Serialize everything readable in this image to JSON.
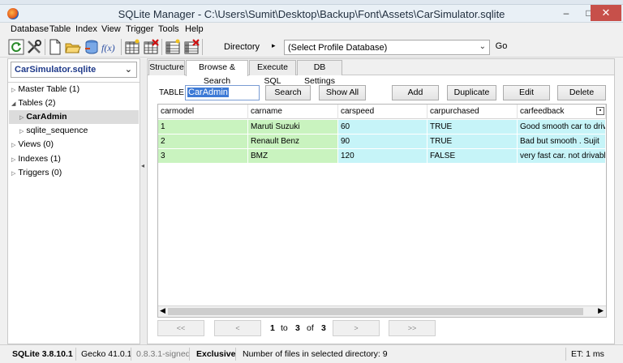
{
  "titlebar": {
    "title": "SQLite Manager - C:\\Users\\Sumit\\Desktop\\Backup\\Font\\Assets\\CarSimulator.sqlite",
    "minimize": "–",
    "maximize": "□",
    "close": "✕"
  },
  "menu": [
    "Database",
    "Table",
    "Index",
    "View",
    "Trigger",
    "Tools",
    "Help"
  ],
  "toolbar": {
    "directory_label": "Directory",
    "directory_arrow": "▸",
    "profile_db": "(Select Profile Database)",
    "go_label": "Go",
    "icons": [
      "refresh-icon",
      "settings-tools-icon",
      "new-db-icon",
      "open-db-icon",
      "connect-db-icon",
      "function-icon",
      "create-table-icon",
      "drop-table-icon",
      "create-index-icon",
      "drop-index-icon"
    ]
  },
  "left_panel": {
    "db_name": "CarSimulator.sqlite",
    "tree": [
      {
        "label": "Master Table (1)",
        "expanded": false,
        "level": 0,
        "selected": false
      },
      {
        "label": "Tables (2)",
        "expanded": true,
        "level": 0,
        "selected": false
      },
      {
        "label": "CarAdmin",
        "expanded": false,
        "level": 1,
        "selected": true
      },
      {
        "label": "sqlite_sequence",
        "expanded": false,
        "level": 1,
        "selected": false
      },
      {
        "label": "Views (0)",
        "expanded": false,
        "level": 0,
        "selected": false
      },
      {
        "label": "Indexes (1)",
        "expanded": false,
        "level": 0,
        "selected": false
      },
      {
        "label": "Triggers (0)",
        "expanded": false,
        "level": 0,
        "selected": false
      }
    ]
  },
  "tabs": [
    {
      "label": "Structure",
      "active": false
    },
    {
      "label": "Browse & Search",
      "active": true
    },
    {
      "label": "Execute SQL",
      "active": false
    },
    {
      "label": "DB Settings",
      "active": false
    }
  ],
  "browse": {
    "table_label": "TABLE",
    "table_value": "CarAdmin",
    "buttons": {
      "search": "Search",
      "show_all": "Show All",
      "add": "Add",
      "duplicate": "Duplicate",
      "edit": "Edit",
      "delete": "Delete"
    },
    "columns": [
      "carmodel",
      "carname",
      "carspeed",
      "carpurchased",
      "carfeedback"
    ],
    "rows": [
      [
        "1",
        "Maruti Suzuki",
        "60",
        "TRUE",
        "Good smooth car to drive"
      ],
      [
        "2",
        "Renault Benz",
        "90",
        "TRUE",
        "Bad but smooth . Sujit"
      ],
      [
        "3",
        "BMZ",
        "120",
        "FALSE",
        "very fast car. not drivable."
      ]
    ],
    "pager": {
      "first": "<<",
      "prev": "<",
      "from": "1",
      "to_word": "to",
      "to": "3",
      "of_word": "of",
      "total": "3",
      "next": ">",
      "last": ">>"
    }
  },
  "status": {
    "sqlite_version": "SQLite 3.8.10.1",
    "gecko_version": "Gecko 41.0.1",
    "ext_version": "0.8.3.1-signed",
    "mode": "Exclusive",
    "files_info": "Number of files in selected directory: 9",
    "timing": "ET: 1 ms"
  },
  "colors": {
    "green_cell": "#c9f3bf",
    "cyan_cell": "#c6f4f8",
    "close_button": "#c7504a",
    "db_name": "#1f3a8a"
  }
}
